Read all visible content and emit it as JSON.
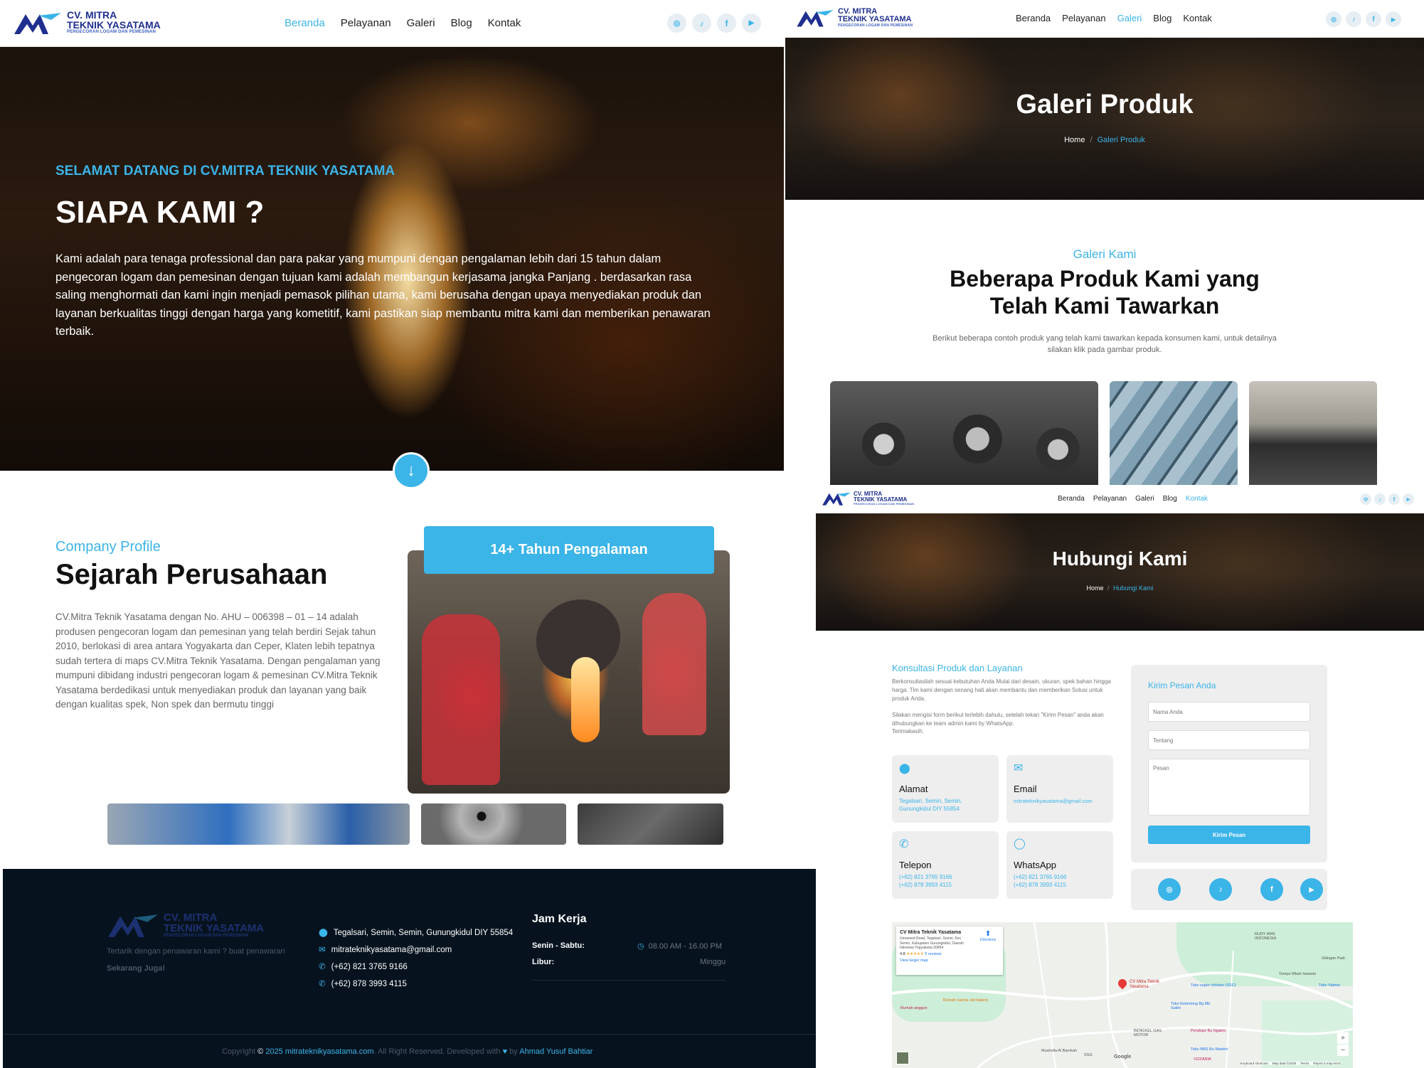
{
  "brand": {
    "name_line1": "CV. MITRA",
    "name_line2": "TEKNIK YASATAMA",
    "tagline": "PENGECORAN LOGAM DAN PEMESINAN"
  },
  "nav": {
    "items": [
      "Beranda",
      "Pelayanan",
      "Galeri",
      "Blog",
      "Kontak"
    ]
  },
  "social_icons": [
    "instagram-icon",
    "tiktok-icon",
    "facebook-icon",
    "youtube-icon"
  ],
  "colors": {
    "accent": "#3bb4e8",
    "brand_dark_blue": "#1f2f8f",
    "footer_bg": "#06131f"
  },
  "home": {
    "hero_kicker": "SELAMAT DATANG DI CV.MITRA TEKNIK YASATAMA",
    "hero_title": "SIAPA KAMI ?",
    "hero_text": "Kami adalah para tenaga professional dan para pakar yang mumpuni dengan pengalaman lebih dari 15 tahun dalam pengecoran logam dan pemesinan dengan tujuan kami adalah membangun kerjasama jangka Panjang . berdasarkan rasa saling menghormati dan kami ingin menjadi pemasok pilihan utama, kami berusaha dengan upaya menyediakan produk dan layanan berkualitas tinggi dengan harga yang kometitif, kami pastikan siap membantu mitra kami dan memberikan penawaran terbaik.",
    "profile_kicker": "Company Profile",
    "profile_title": "Sejarah Perusahaan",
    "profile_text": "CV.Mitra Teknik Yasatama dengan No. AHU – 006398 – 01 – 14 adalah produsen pengecoran logam dan pemesinan yang telah berdiri Sejak tahun 2010, berlokasi di area antara Yogyakarta dan Ceper, Klaten lebih tepatnya sudah tertera di maps CV.Mitra Teknik Yasatama. Dengan pengalaman yang mumpuni dibidang industri pengecoran logam & pemesinan CV.Mitra Teknik Yasatama berdedikasi untuk menyediakan produk dan layanan yang baik dengan kualitas spek, Non spek dan bermutu tinggi",
    "experience_badge": "14+ Tahun Pengalaman"
  },
  "footer": {
    "tagline": "Tertarik dengan penawaran kami ? buat penawaran",
    "tagline_bold": "Sekarang Juga!",
    "address": "Tegalsari, Semin, Semin, Gunungkidul DIY 55854",
    "email": "mitrateknikyasatama@gmail.com",
    "phone1": "(+62) 821 3765 9166",
    "phone2": "(+62) 878 3993 4115",
    "hours_title": "Jam Kerja",
    "days1": "Senin - Sabtu:",
    "hours1": "08.00 AM - 16.00 PM",
    "days2": "Libur:",
    "hours2": "Minggu",
    "copyright_prefix": "Copyright",
    "copyright_year": "2025",
    "copyright_site": "mitrateknikyasatama.com",
    "copyright_mid": ". All Right Reserved. Developed with",
    "copyright_by": "by",
    "developer": "Ahmad Yusuf Bahtiar"
  },
  "gallery": {
    "banner_title": "Galeri Produk",
    "crumb_home": "Home",
    "crumb_sep": "/",
    "crumb_current": "Galeri Produk",
    "kicker": "Galeri Kami",
    "title_line1": "Beberapa Produk Kami yang",
    "title_line2": "Telah Kami Tawarkan",
    "desc_line1": "Berikut beberapa contoh produk yang telah kami tawarkan kepada konsumen kami, untuk detailnya",
    "desc_line2": "silakan klik pada gambar produk."
  },
  "contact": {
    "banner_title": "Hubungi Kami",
    "crumb_home": "Home",
    "crumb_sep": "/",
    "crumb_current": "Hubungi Kami",
    "kicker": "Konsultasi Produk dan Layanan",
    "text1": "Berkonsultasilah sesuai kebutuhan Anda Mulai dari desain, ukuran, spek bahan hingga harga. Tim kami dengan senang hati akan membantu dan memberikan Solusi untuk produk Anda.",
    "text2": "Silakan mengisi form berikut terlebih dahulu, setelah tekan \"Kirim Pesan\" anda akan dihubungkan ke team admin kami by WhatsApp.",
    "text3": "Terimakasih.",
    "cards": [
      {
        "icon": "map-pin-icon",
        "title": "Alamat",
        "lines": [
          "Tegalsari, Semin, Semin,",
          "Gunungkidul DIY 55854"
        ]
      },
      {
        "icon": "mail-icon",
        "title": "Email",
        "lines": [
          "mitrateknikyasatama@gmail.com"
        ]
      },
      {
        "icon": "phone-icon",
        "title": "Telepon",
        "lines": [
          "(+62) 821 3765 9166",
          "(+62) 878 3993 4115"
        ]
      },
      {
        "icon": "whatsapp-icon",
        "title": "WhatsApp",
        "lines": [
          "(+62) 821 3765 9166",
          "(+62) 878 3993 4115"
        ]
      }
    ],
    "form_title": "Kirim Pesan Anda",
    "name_placeholder": "Nama Anda",
    "subject_placeholder": "Tentang",
    "message_placeholder": "Pesan",
    "submit_label": "Kirim Pesan"
  },
  "map": {
    "place_name": "CV Mitra Teknik Yasatama",
    "place_address": "Unnamed Road, Tegalsari, Semin, Kec. Semin, Kabupaten Gunungkidul, Daerah Istimewa Yogyakarta 55854",
    "rating": "4.8",
    "stars": "★★★★★",
    "reviews": "5 reviews",
    "view_larger": "View larger map",
    "directions": "Directions",
    "marker_label": "CV Mitra Teknik Yasatama",
    "labels": [
      "RUDY AMS INDONESIA",
      "Toko super chicken (SSC)",
      "Tempe Mbah Iswanto",
      "Toko Yatmin",
      "Gilingan Padi",
      "Rumah sukma ciel bakery",
      "Rumah anggun",
      "Toko Kelontong Bg Mb Sutini",
      "Pendopo Bu Ngatini",
      "BENGKEL GAS MOTOR",
      "Musholla Al Barokah",
      "Toko NBS Bu Wastini",
      "VIZZARIA",
      "SSG",
      "Google"
    ],
    "footer_items": [
      "Keyboard shortcuts",
      "Map data ©2025",
      "Terms",
      "Report a map error"
    ]
  }
}
